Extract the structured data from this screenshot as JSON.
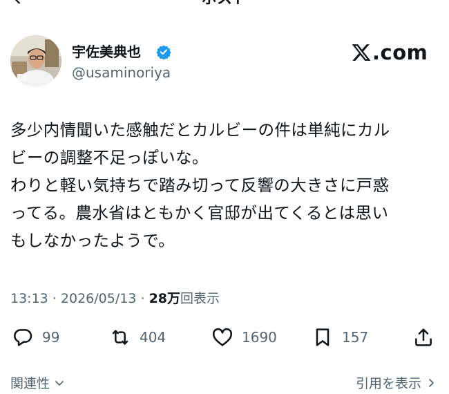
{
  "header": {
    "title": "ポスト",
    "back_icon": "back-arrow-icon"
  },
  "author": {
    "name": "宇佐美典也",
    "handle": "@usaminoriya",
    "verified": true,
    "verified_color": "#1d9bf0"
  },
  "brand": {
    "logo_text": ".com"
  },
  "post": {
    "text": "多少内情聞いた感触だとカルビーの件は単純にカル\nビーの調整不足っぽいな。\nわりと軽い気持ちで踏み切って反響の大きさに戸惑\nってる。農水省はともかく官邸が出てくるとは思い\nもしなかったようで。"
  },
  "meta": {
    "time": "13:13",
    "separator": "·",
    "date": "2026/05/13",
    "dot": "·",
    "views_count": "28万",
    "views_label": "回表示"
  },
  "actions": {
    "reply_count": "99",
    "repost_count": "404",
    "like_count": "1690",
    "bookmark_count": "157"
  },
  "footer": {
    "related_label": "関連性",
    "quotes_label": "引用を表示"
  },
  "colors": {
    "text": "#0f1419",
    "muted": "#536471",
    "accent": "#1d9bf0"
  }
}
